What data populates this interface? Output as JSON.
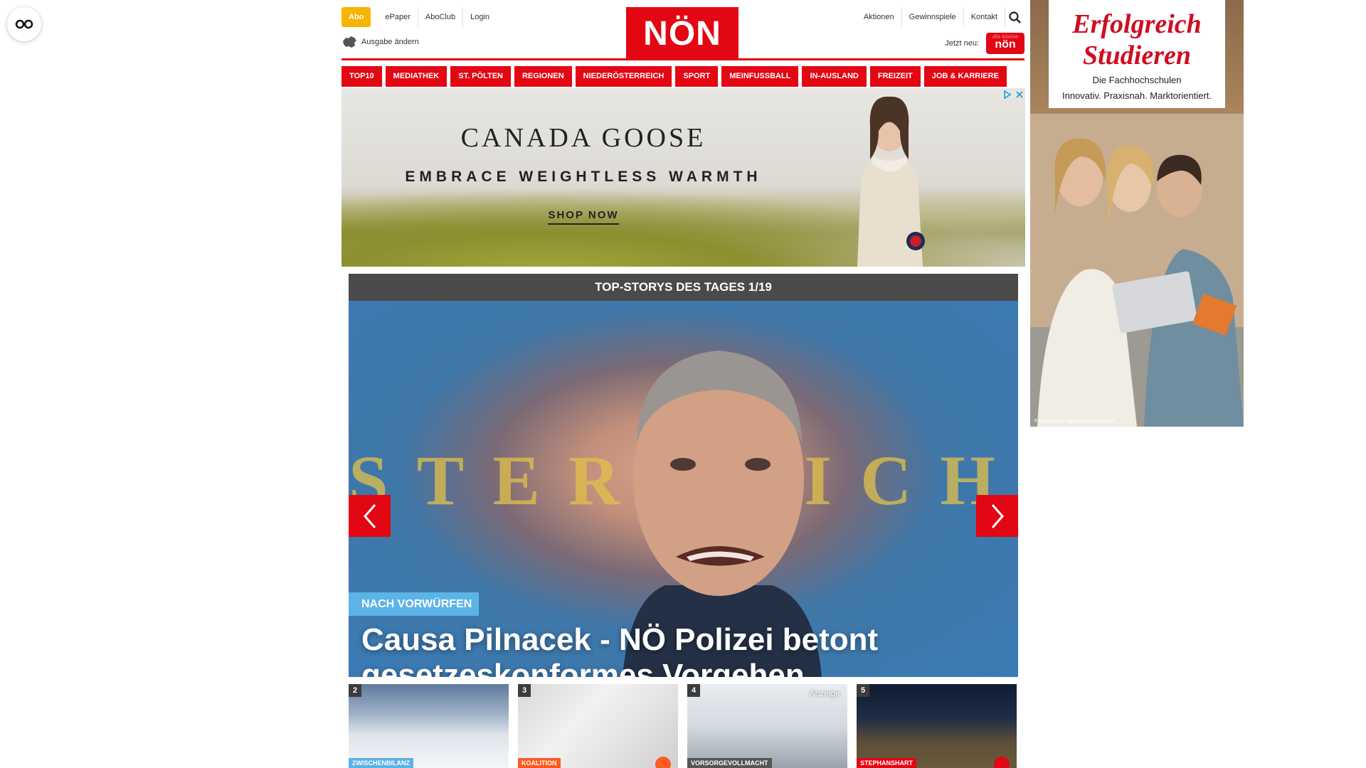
{
  "controls": {
    "cg_icon": "glasses-icon"
  },
  "header": {
    "abo_label": "Abo",
    "left_links": [
      "ePaper",
      "AboClub",
      "Login"
    ],
    "edition_label": "Ausgabe ändern",
    "logo_text": "NÖN",
    "right_links": [
      "Aktionen",
      "Gewinnspiele",
      "Kontakt"
    ],
    "jetzt_label": "Jetzt neu:",
    "kids_logo_top": "die kleine",
    "kids_logo_text": "nön",
    "brand_color": "#e30613",
    "abo_color": "#f7b400"
  },
  "nav": {
    "items": [
      "TOP10",
      "MEDIATHEK",
      "ST. PÖLTEN",
      "REGIONEN",
      "NIEDERÖSTERREICH",
      "SPORT",
      "MEINFUSSBALL",
      "IN-AUSLAND",
      "FREIZEIT",
      "JOB & KARRIERE"
    ]
  },
  "ad_banner": {
    "brand": "CANADA GOOSE",
    "tagline": "EMBRACE WEIGHTLESS WARMTH",
    "cta": "SHOP NOW"
  },
  "topstory": {
    "header": "TOP-STORYS DES TAGES 1/19",
    "watermark": "STERREICH",
    "label": "NACH VORWÜRFEN",
    "title": "Causa Pilnacek - NÖ Polizei betont gesetzeskonformes Vorgehen",
    "label_color": "#5bb3e6"
  },
  "thumbs": [
    {
      "num": "2",
      "tag": "ZWISCHENBILANZ",
      "tag_color": "#5bb3e6"
    },
    {
      "num": "3",
      "tag": "KOALITION",
      "tag_color": "#ff5a1f"
    },
    {
      "num": "4",
      "tag": "VORSORGEVOLLMACHT",
      "tag_color": "#555555",
      "ad_label": "Anzeige"
    },
    {
      "num": "5",
      "tag": "STEPHANSHART",
      "tag_color": "#e30613"
    }
  ],
  "side_ad": {
    "title": "Erfolgreich Studieren",
    "line1": "Die Fachhochschulen",
    "line2": "Innovativ. Praxisnah. Marktorientiert.",
    "photo_credit": "Foto: Drazen Zigic/Shutterstock.com"
  }
}
